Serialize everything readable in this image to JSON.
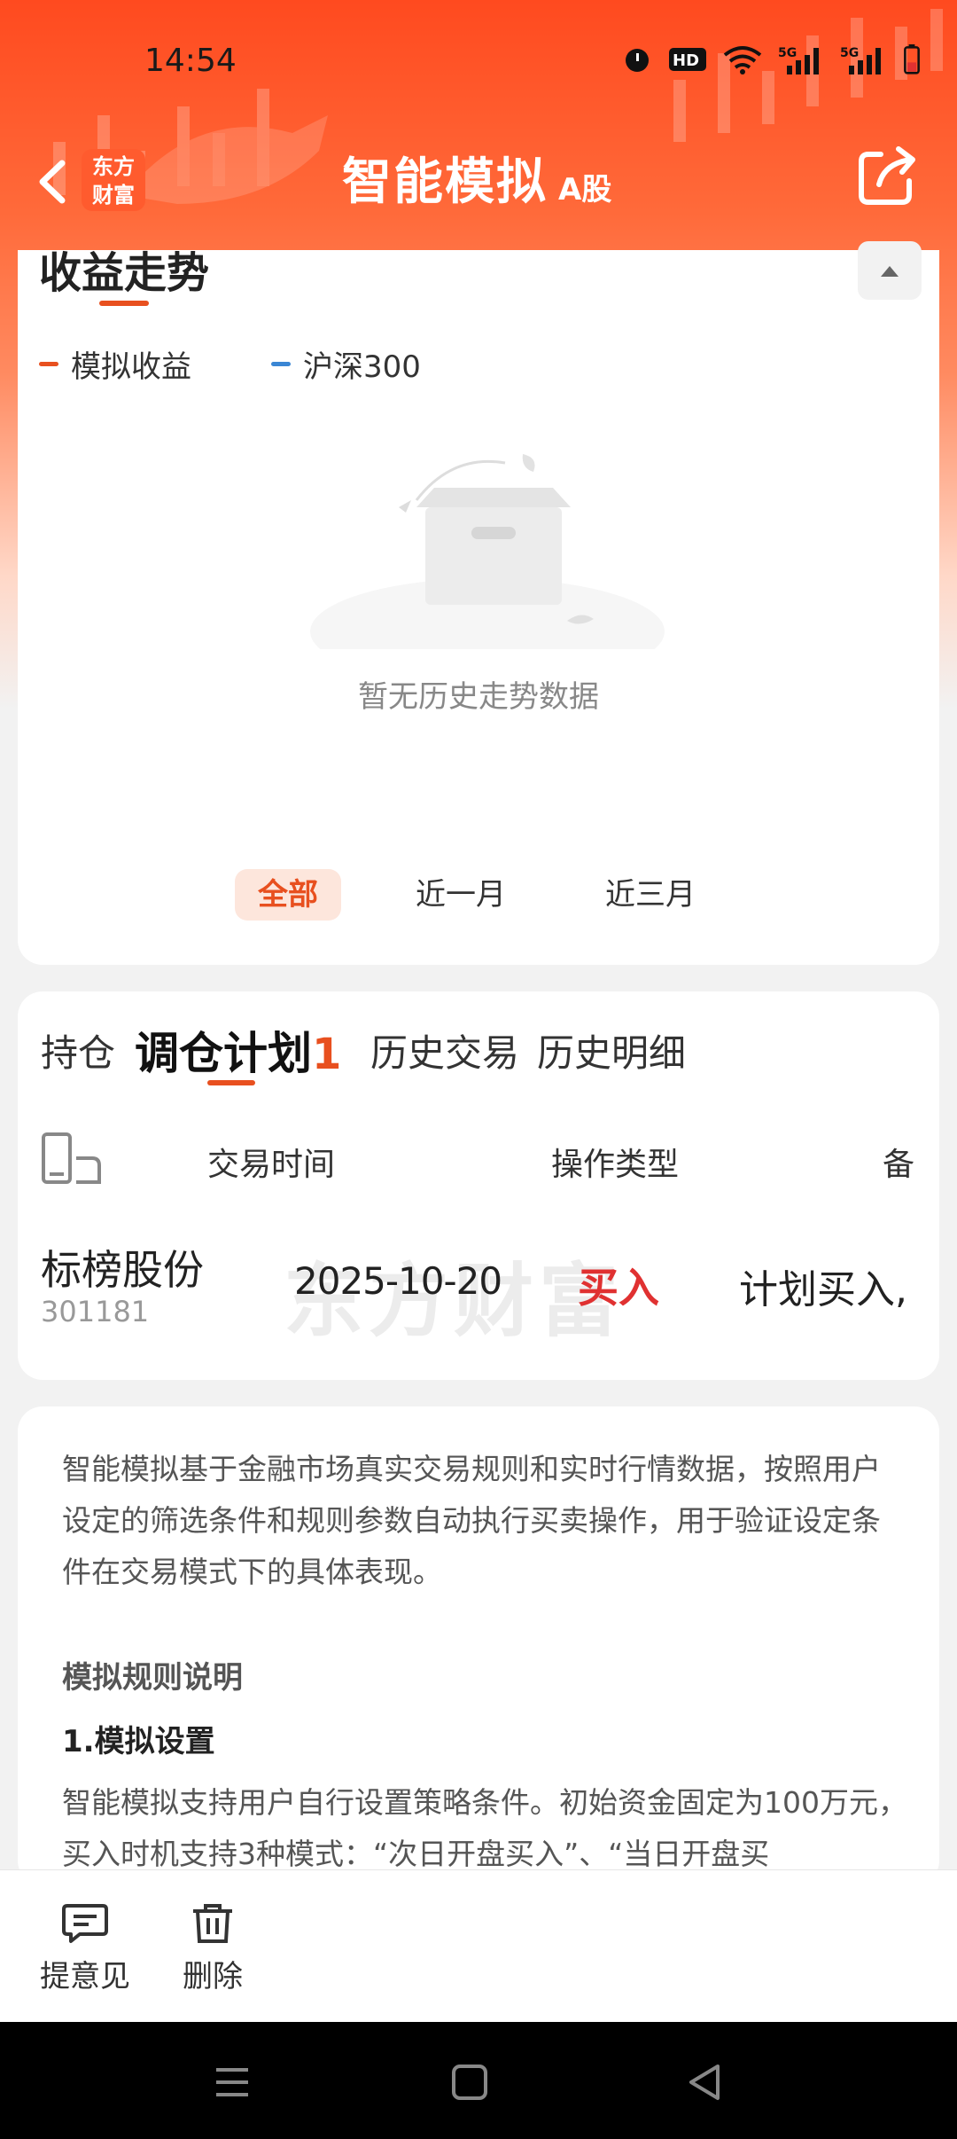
{
  "status_bar": {
    "time": "14:54",
    "icons": [
      "alarm-icon",
      "hd-icon",
      "wifi-icon",
      "signal-5g-icon",
      "signal-5g-icon",
      "battery-icon"
    ]
  },
  "nav": {
    "logo_line1": "东方",
    "logo_line2": "财富",
    "title": "智能模拟",
    "subtitle": "A股"
  },
  "earnings_card": {
    "title": "收益走势",
    "legend": [
      {
        "label": "模拟收益",
        "color": "#e8501f"
      },
      {
        "label": "沪深300",
        "color": "#3a86d4"
      }
    ],
    "empty_text": "暂无历史走势数据",
    "ranges": [
      "全部",
      "近一月",
      "近三月"
    ],
    "active_range": "全部"
  },
  "plans_card": {
    "tabs": [
      "持仓",
      "调仓计划",
      "历史交易",
      "历史明细"
    ],
    "active_tab": "调仓计划",
    "badge": "1",
    "columns": [
      "交易时间",
      "操作类型",
      "备"
    ],
    "rows": [
      {
        "name": "标榜股份",
        "code": "301181",
        "date": "2025-10-20",
        "type": "买入",
        "note": "计划买入,"
      }
    ],
    "watermark": "东方财富"
  },
  "intro_card": {
    "description": "智能模拟基于金融市场真实交易规则和实时行情数据，按照用户设定的筛选条件和规则参数自动执行买卖操作，用于验证设定条件在交易模式下的具体表现。",
    "rules_title": "模拟规则说明",
    "section_title": "1.模拟设置",
    "section_text": "智能模拟支持用户自行设置策略条件。初始资金固定为100万元，买入时机支持3种模式：“次日开盘买入”、“当日开盘买"
  },
  "actions": [
    {
      "label": "提意见",
      "icon": "feedback-icon"
    },
    {
      "label": "删除",
      "icon": "trash-icon"
    }
  ],
  "system_nav": [
    "menu-icon",
    "home-icon",
    "back-icon"
  ]
}
